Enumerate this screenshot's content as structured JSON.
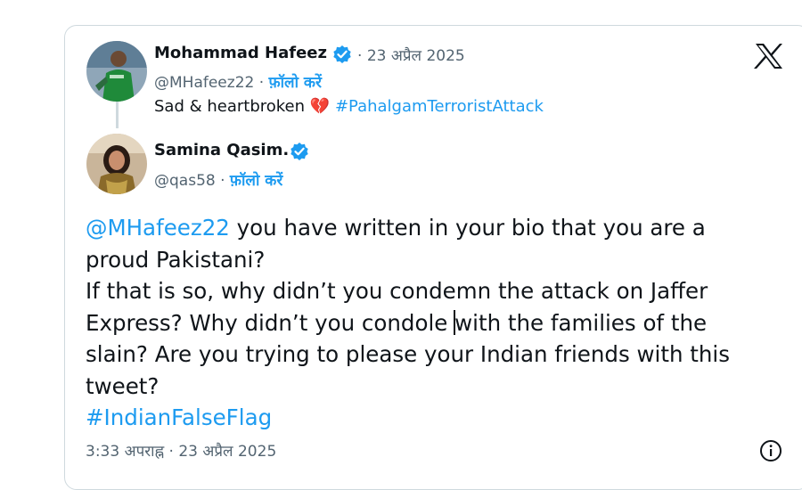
{
  "quoted_tweet": {
    "author_name": "Mohammad Hafeez",
    "date": "23 अप्रैल 2025",
    "handle": "@MHafeez22",
    "follow_label": "फ़ॉलो करें",
    "text": "Sad & heartbroken",
    "emoji": "💔",
    "hashtag": "#PahalgamTerroristAttack",
    "avatar_icon": "cricketer-green-jersey-avatar"
  },
  "reply_tweet": {
    "author_name": "Samina Qasim.",
    "handle": "@qas58",
    "follow_label": "फ़ॉलो करें",
    "avatar_icon": "woman-portrait-avatar",
    "body": {
      "mention": "@MHafeez22",
      "line1_rest": " you have written in your bio that you are a",
      "line2": "proud Pakistani?",
      "line3": "If that is so, why didn’t you condemn the attack on Jaffer",
      "line4_a": "Express? Why didn’t you condole ",
      "line4_b": "with the families of the",
      "line5": "slain? Are you trying to please your Indian friends with this",
      "line6": "tweet?",
      "hashtag": "#IndianFalseFlag"
    },
    "timestamp": "3:33 अपराह्न · 23 अप्रैल 2025"
  },
  "icons": {
    "platform": "x-logo-icon",
    "info": "info-icon",
    "verified": "verified-badge-icon"
  },
  "colors": {
    "link": "#1d9bf0",
    "text": "#0f1419",
    "muted": "#536471",
    "border": "#cfd9de"
  }
}
